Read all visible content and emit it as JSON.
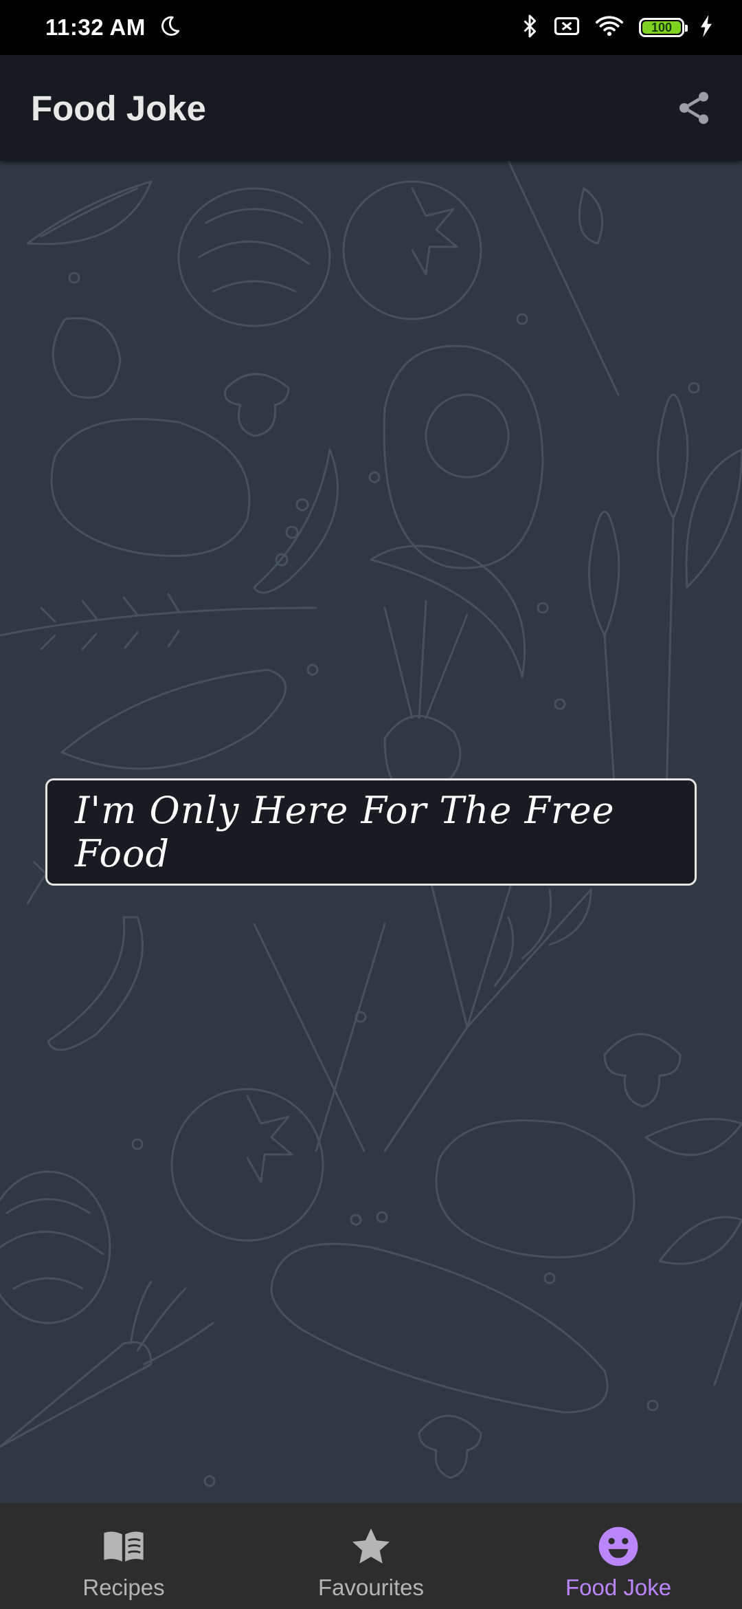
{
  "status_bar": {
    "time": "11:32 AM",
    "battery_level": "100",
    "icons": [
      "moon-icon",
      "bluetooth-icon",
      "no-sim-icon",
      "wifi-icon",
      "battery-icon",
      "charging-icon"
    ]
  },
  "app_bar": {
    "title": "Food Joke",
    "share_icon": "share-icon"
  },
  "joke": {
    "text": "I'm Only Here For The Free Food"
  },
  "bottom_nav": {
    "items": [
      {
        "label": "Recipes",
        "icon": "book-icon",
        "active": false
      },
      {
        "label": "Favourites",
        "icon": "star-icon",
        "active": false
      },
      {
        "label": "Food Joke",
        "icon": "smiley-icon",
        "active": true
      }
    ]
  },
  "colors": {
    "accent": "#bb86fc",
    "app_bar_bg": "#161b22",
    "content_bg": "#303841",
    "nav_bg": "#2d2d2d",
    "battery_fill": "#7ed321"
  }
}
